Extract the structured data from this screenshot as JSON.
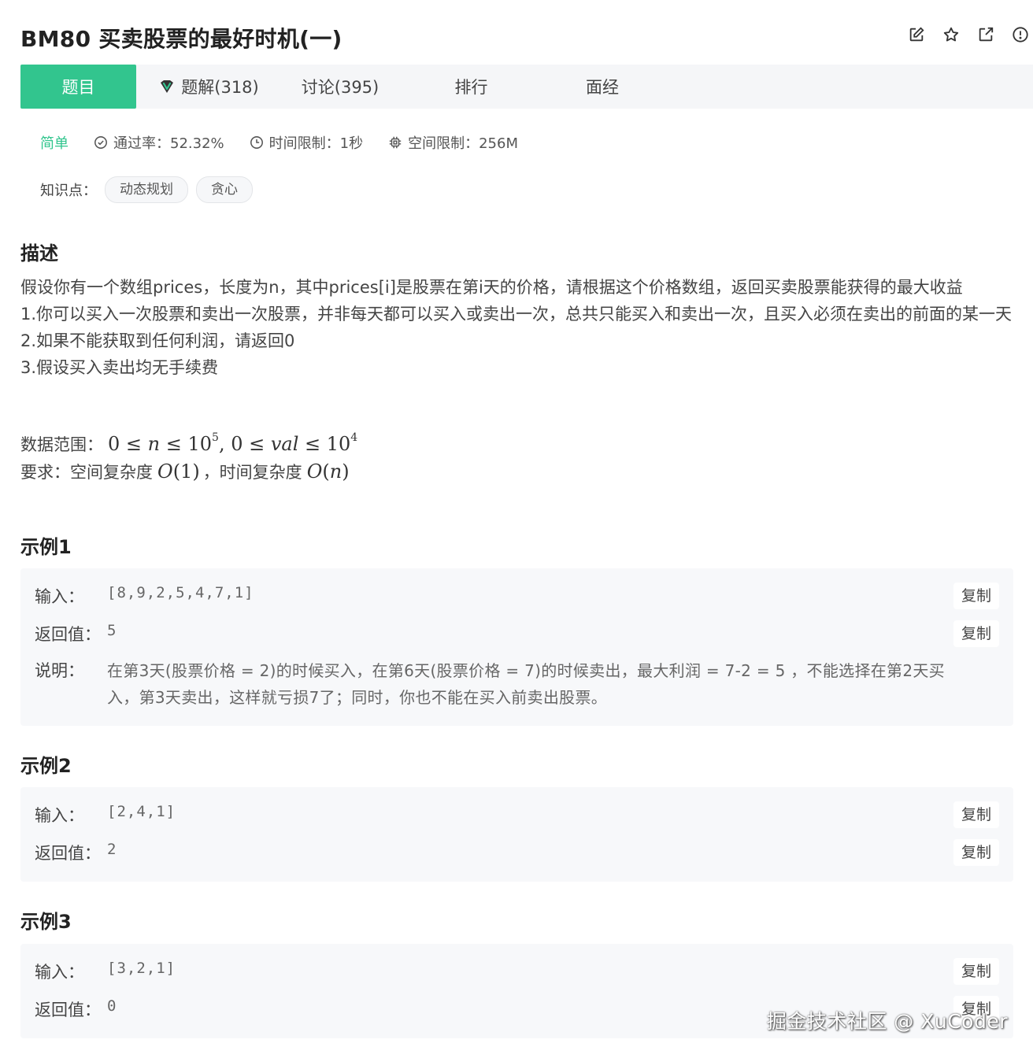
{
  "header": {
    "title": "BM80  买卖股票的最好时机(一)"
  },
  "tabs": [
    {
      "label": "题目",
      "active": true
    },
    {
      "label": "题解(318)"
    },
    {
      "label": "讨论(395)"
    },
    {
      "label": "排行"
    },
    {
      "label": "面经"
    }
  ],
  "meta": {
    "level": "简单",
    "pass_rate": "通过率：52.32%",
    "time_limit": "时间限制：1秒",
    "space_limit": "空间限制：256M"
  },
  "knowledge": {
    "label": "知识点：",
    "tags": [
      "动态规划",
      "贪心"
    ]
  },
  "description": {
    "heading": "描述",
    "lines": [
      "假设你有一个数组prices，长度为n，其中prices[i]是股票在第i天的价格，请根据这个价格数组，返回买卖股票能获得的最大收益",
      "1.你可以买入一次股票和卖出一次股票，并非每天都可以买入或卖出一次，总共只能买入和卖出一次，且买入必须在卖出的前面的某一天",
      "2.如果不能获取到任何利润，请返回0",
      "3.假设买入卖出均无手续费"
    ],
    "range_label": "数据范围：",
    "requirement_label": "要求：空间复杂度",
    "time_label": "，时间复杂度"
  },
  "examples": [
    {
      "heading": "示例1",
      "input_label": "输入：",
      "input": "[8,9,2,5,4,7,1]",
      "output_label": "返回值：",
      "output": "5",
      "note_label": "说明：",
      "note": "在第3天(股票价格 = 2)的时候买入，在第6天(股票价格 = 7)的时候卖出，最大利润 = 7-2 = 5 ，不能选择在第2天买入，第3天卖出，这样就亏损7了；同时，你也不能在买入前卖出股票。",
      "copy_label": "复制"
    },
    {
      "heading": "示例2",
      "input_label": "输入：",
      "input": "[2,4,1]",
      "output_label": "返回值：",
      "output": "2",
      "copy_label": "复制"
    },
    {
      "heading": "示例3",
      "input_label": "输入：",
      "input": "[3,2,1]",
      "output_label": "返回值：",
      "output": "0",
      "copy_label": "复制"
    }
  ],
  "watermark": "掘金技术社区 @ XuCoder",
  "colors": {
    "accent": "#32c58e",
    "tab_bar": "#f5f6f8",
    "example_bg": "#f7f8fa"
  }
}
